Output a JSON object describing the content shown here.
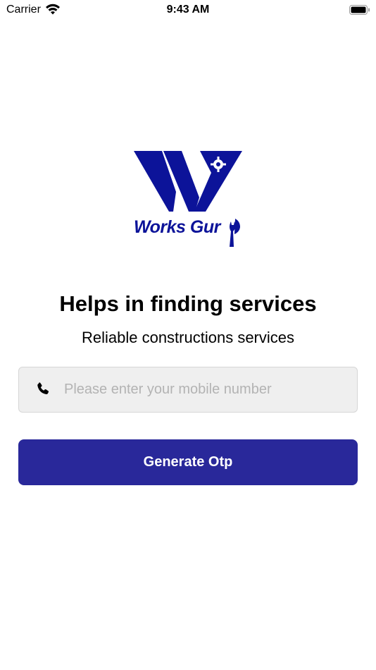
{
  "status_bar": {
    "carrier": "Carrier",
    "time": "9:43 AM",
    "icons": [
      "wifi-icon",
      "battery-icon"
    ]
  },
  "logo": {
    "text": "Works Gur",
    "brand_color": "#0c1399"
  },
  "headline": "Helps in finding services",
  "subheadline": "Reliable constructions services",
  "phone_field": {
    "icon": "phone-icon",
    "placeholder": "Please enter your mobile number",
    "value": ""
  },
  "otp_button": {
    "label": "Generate Otp",
    "color": "#29289a"
  }
}
